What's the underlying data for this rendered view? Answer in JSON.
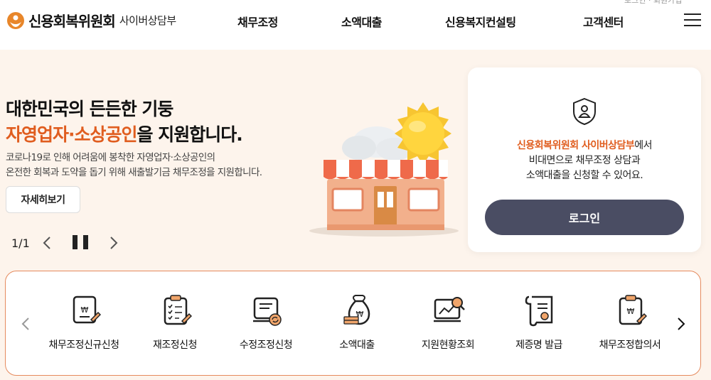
{
  "header": {
    "logo_text": "신용회복위원회",
    "logo_sub": "사이버상담부",
    "top_util": "로그인 · 회원가입",
    "nav": [
      "채무조정",
      "소액대출",
      "신용복지컨설팅",
      "고객센터"
    ],
    "menu_icon": "hamburger-icon"
  },
  "hero": {
    "headline1": "대한민국의 든든한 기둥",
    "headline2_accent": "자영업자·소상공인",
    "headline2_rest": "을 지원합니다.",
    "desc_line1": "코로나19로 인해 어려움에 봉착한 자영업자·소상공인의",
    "desc_line2": "온전한 회복과 도약을 돕기 위해 새출발기금 채무조정을 지원합니다.",
    "more_label": "자세히보기",
    "pager": "1/1"
  },
  "login_card": {
    "accent": "신용회복위원회 사이버상담부",
    "line1_rest": "에서",
    "line2": "비대면으로 채무조정 상담과",
    "line3": "소액대출을 신청할 수 있어요.",
    "button": "로그인"
  },
  "quick_menu": {
    "items": [
      {
        "label": "채무조정신규신청",
        "icon": "document-won-icon"
      },
      {
        "label": "재조정신청",
        "icon": "checklist-icon"
      },
      {
        "label": "수정조정신청",
        "icon": "document-refresh-icon"
      },
      {
        "label": "소액대출",
        "icon": "money-bag-icon"
      },
      {
        "label": "지원현황조회",
        "icon": "chart-search-icon"
      },
      {
        "label": "제증명 발급",
        "icon": "certificate-scroll-icon"
      },
      {
        "label": "채무조정합의서",
        "icon": "clipboard-won-icon"
      }
    ]
  },
  "colors": {
    "accent": "#e05d1f",
    "hero_bg": "#fdf4ec",
    "login_button": "#4a4d63"
  }
}
